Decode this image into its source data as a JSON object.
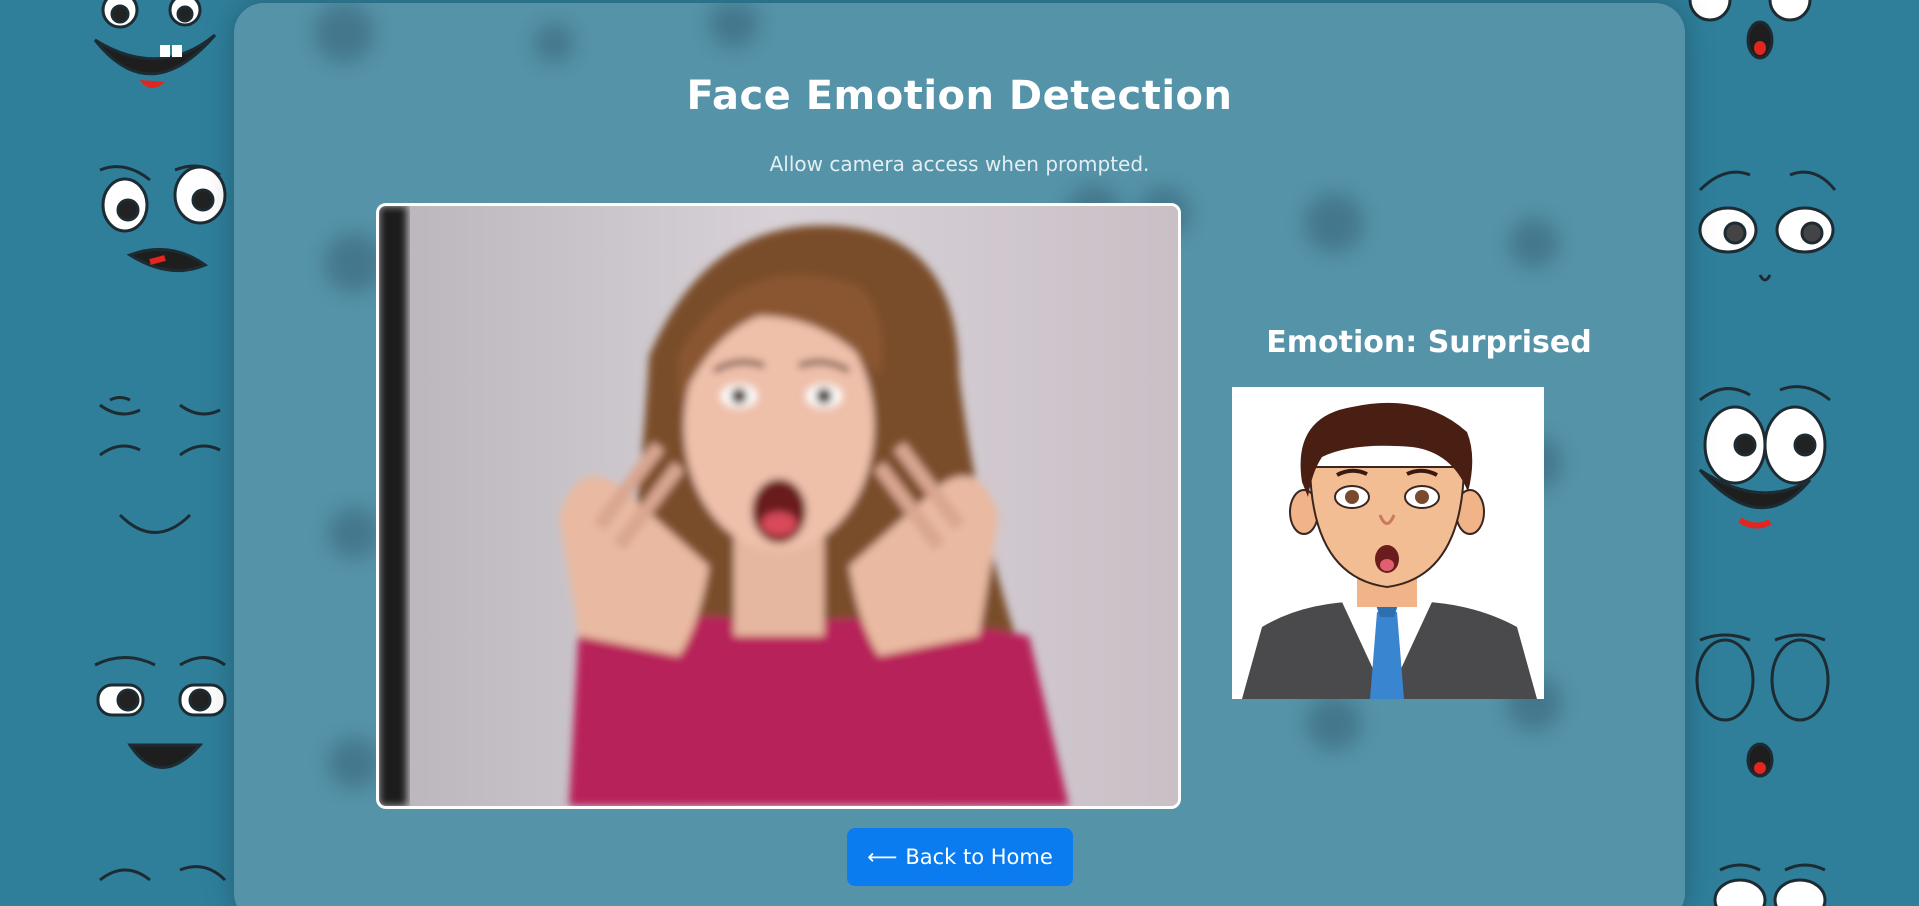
{
  "page": {
    "title": "Face Emotion Detection",
    "subtitle": "Allow camera access when prompted."
  },
  "camera": {
    "feed_label": "camera-feed"
  },
  "result": {
    "emotion_text": "Emotion: Surprised",
    "emoji_icon": "surprised-cartoon-man-icon"
  },
  "nav": {
    "back_arrow": "⟵",
    "back_label": "Back to Home"
  },
  "colors": {
    "background": "#2f7f9b",
    "panel": "#6ea0b2",
    "button": "#0b7cf0",
    "text": "#ffffff"
  }
}
